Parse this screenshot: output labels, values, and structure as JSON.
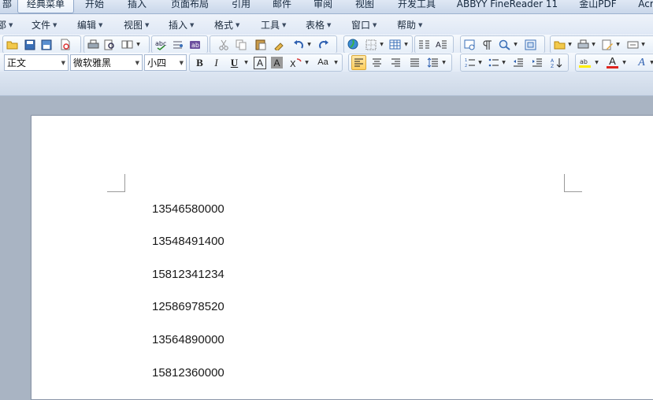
{
  "tabs": [
    {
      "label": "部"
    },
    {
      "label": "经典菜单",
      "active": true
    },
    {
      "label": "开始"
    },
    {
      "label": "插入"
    },
    {
      "label": "页面布局"
    },
    {
      "label": "引用"
    },
    {
      "label": "邮件"
    },
    {
      "label": "审阅"
    },
    {
      "label": "视图"
    },
    {
      "label": "开发工具"
    },
    {
      "label": "ABBYY FineReader 11"
    },
    {
      "label": "金山PDF"
    },
    {
      "label": "Acr"
    }
  ],
  "menu": [
    {
      "label": "邵"
    },
    {
      "label": "文件"
    },
    {
      "label": "编辑"
    },
    {
      "label": "视图"
    },
    {
      "label": "插入"
    },
    {
      "label": "格式"
    },
    {
      "label": "工具"
    },
    {
      "label": "表格"
    },
    {
      "label": "窗口"
    },
    {
      "label": "帮助"
    }
  ],
  "format": {
    "style": "正文",
    "font": "微软雅黑",
    "size": "小四",
    "bold_label": "B",
    "italic_label": "I",
    "underline_label": "U",
    "border_label": "A",
    "shade_label": "A",
    "case_label": "Aa",
    "color_label": "A",
    "effect_label": "A"
  },
  "colors": {
    "accent": "#ffcf5e",
    "font_color": "#e0241e",
    "highlight": "#ffee00"
  },
  "document": {
    "lines": [
      "13546580000",
      "13548491400",
      "15812341234",
      "12586978520",
      "13564890000",
      "15812360000"
    ]
  }
}
